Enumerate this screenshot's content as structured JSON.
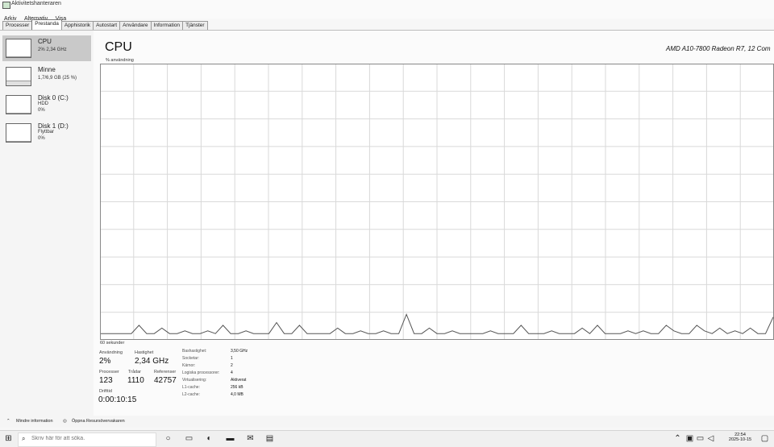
{
  "window": {
    "title": "Aktivitetshanteraren"
  },
  "menu": [
    "Arkiv",
    "Alternativ",
    "Visa"
  ],
  "tabs": [
    "Processer",
    "Prestanda",
    "Apphistorik",
    "Autostart",
    "Användare",
    "Information",
    "Tjänster"
  ],
  "active_tab": "Prestanda",
  "sidebar": {
    "items": [
      {
        "title": "CPU",
        "sub1": "2% 2,34 GHz",
        "sub2": "",
        "level": 0.02,
        "selected": true
      },
      {
        "title": "Minne",
        "sub1": "1,7/6,9 GB (25 %)",
        "sub2": "",
        "level": 0.25,
        "selected": false
      },
      {
        "title": "Disk 0 (C:)",
        "sub1": "HDD",
        "sub2": "0%",
        "level": 0.0,
        "selected": false
      },
      {
        "title": "Disk 1 (D:)",
        "sub1": "Flyttbar",
        "sub2": "0%",
        "level": 0.0,
        "selected": false
      }
    ]
  },
  "main": {
    "title": "CPU",
    "model": "AMD A10-7800 Radeon R7, 12 Com",
    "usage_label": "% användning",
    "time_label": "60 sekunder"
  },
  "chart_data": {
    "type": "line",
    "ylim": [
      0,
      100
    ],
    "grid": true,
    "x_points": 60,
    "values": [
      2,
      2,
      2,
      2,
      2,
      5,
      2,
      2,
      4,
      2,
      2,
      3,
      2,
      2,
      3,
      2,
      5,
      2,
      2,
      3,
      2,
      2,
      2,
      6,
      2,
      2,
      5,
      2,
      2,
      2,
      2,
      4,
      2,
      2,
      3,
      2,
      2,
      3,
      2,
      2,
      9,
      2,
      2,
      4,
      2,
      2,
      3,
      2,
      2,
      2,
      2,
      3,
      2,
      2,
      2,
      5,
      2,
      2,
      2,
      3,
      2,
      2,
      2,
      4,
      2,
      5,
      2,
      2,
      2,
      3,
      2,
      3,
      2,
      2,
      5,
      3,
      2,
      2,
      5,
      3,
      2,
      4,
      2,
      3,
      2,
      4,
      2,
      2,
      8
    ]
  },
  "stats": {
    "usage": {
      "label": "Användning",
      "value": "2%"
    },
    "speed": {
      "label": "Hastighet",
      "value": "2,34 GHz"
    },
    "processes": {
      "label": "Processer",
      "value": "123"
    },
    "threads": {
      "label": "Trådar",
      "value": "1110"
    },
    "handles": {
      "label": "Referenser",
      "value": "42757"
    },
    "uptime": {
      "label": "Drifttid",
      "value": "0:00:10:15"
    }
  },
  "specs": [
    {
      "key": "Bashastighet:",
      "value": "3,50 GHz"
    },
    {
      "key": "Socketar:",
      "value": "1"
    },
    {
      "key": "Kärnor:",
      "value": "2"
    },
    {
      "key": "Logiska processorer:",
      "value": "4"
    },
    {
      "key": "Virtualisering:",
      "value": "Aktiverat"
    },
    {
      "key": "L1-cache:",
      "value": "256 kB"
    },
    {
      "key": "L2-cache:",
      "value": "4,0 MB"
    }
  ],
  "bottom": {
    "fewer_details": "Mindre information",
    "open_monitor": "Öppna Resursövervakaren"
  },
  "taskbar": {
    "search_placeholder": "Skriv här för att söka.",
    "time": "22:54",
    "date": "2025-10-15"
  }
}
